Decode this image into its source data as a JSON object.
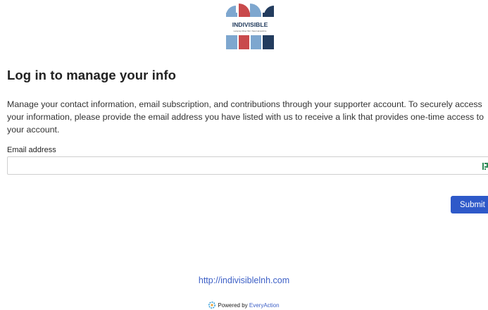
{
  "logo": {
    "name": "INDIVISIBLE",
    "tagline": "Lamprey River NH / New Hampshire",
    "colors": {
      "light_blue": "#7ea7cf",
      "red": "#c94a4c",
      "navy": "#233c5e"
    }
  },
  "page": {
    "title": "Log in to manage your info",
    "description": "Manage your contact information, email subscription, and contributions through your supporter account. To securely access your information, please provide the email address you have listed with us to receive a link that provides one-time access to your account."
  },
  "form": {
    "email_label": "Email address",
    "email_value": "",
    "email_placeholder": "",
    "submit_label": "Submit"
  },
  "footer": {
    "site_link": "http://indivisiblelnh.com",
    "powered_by": "Powered by",
    "powered_brand": "EveryAction"
  },
  "icons": {
    "input_icon": "password-manager-icon",
    "powered_icon": "everyaction-gear-icon"
  },
  "colors": {
    "submit_bg": "#2e59c9",
    "link": "#3c5fc6"
  }
}
